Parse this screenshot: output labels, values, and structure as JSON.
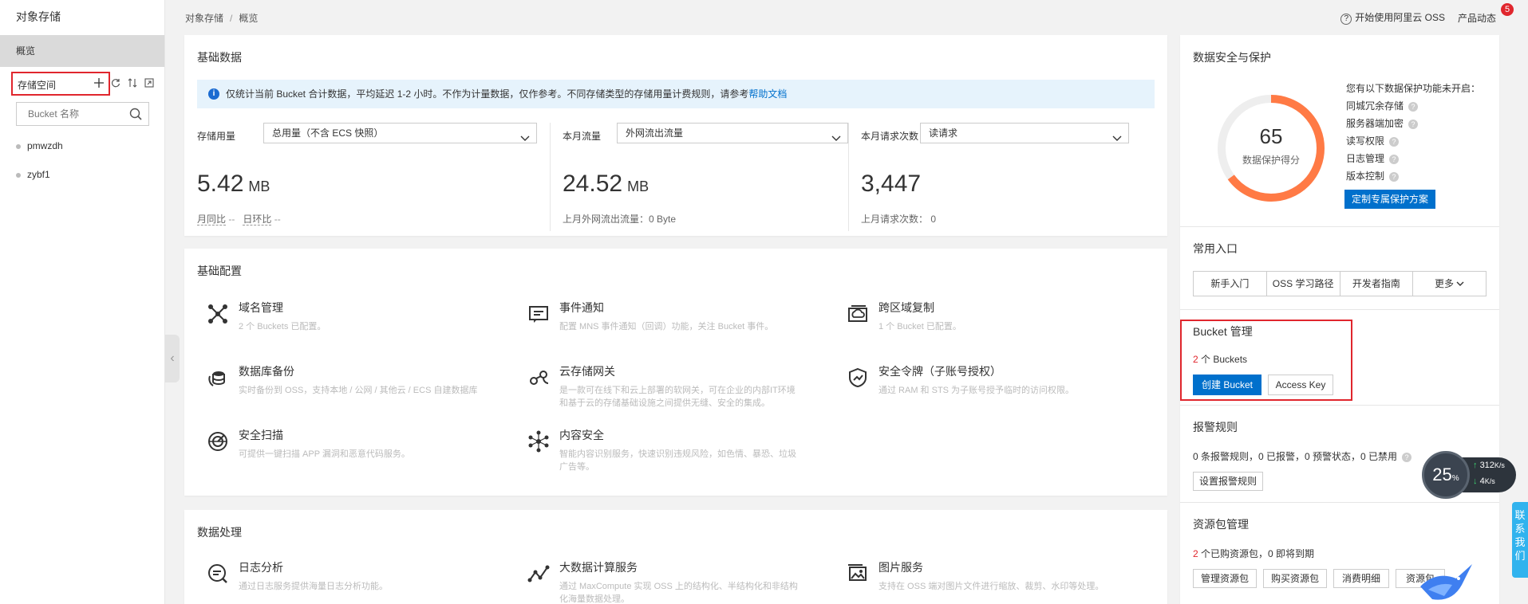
{
  "sidebar": {
    "title": "对象存储",
    "overview": "概览",
    "section_label": "存储空间",
    "search_placeholder": "Bucket 名称",
    "buckets": [
      "pmwzdh",
      "zybf1"
    ]
  },
  "topbar": {
    "breadcrumb": [
      "对象存储",
      "概览"
    ],
    "help_link": "开始使用阿里云 OSS",
    "product_news": "产品动态",
    "news_count": "5"
  },
  "basic_data": {
    "title": "基础数据",
    "notice": "仅统计当前 Bucket 合计数据，平均延迟 1-2 小时。不作为计量数据，仅作参考。不同存储类型的存储用量计费规则，请参考",
    "notice_link": "帮助文档",
    "stats": [
      {
        "label": "存储用量",
        "select": "总用量（不含 ECS 快照）",
        "value": "5.42",
        "unit": "MB",
        "sub_a": "月同比",
        "sub_a_val": "--",
        "sub_b": "日环比",
        "sub_b_val": "--"
      },
      {
        "label": "本月流量",
        "select": "外网流出流量",
        "value": "24.52",
        "unit": "MB",
        "sub": "上月外网流出流量：0 Byte"
      },
      {
        "label": "本月请求次数",
        "select": "读请求",
        "value": "3,447",
        "unit": "",
        "sub": "上月请求次数：   0"
      }
    ]
  },
  "basic_config": {
    "title": "基础配置",
    "features": [
      {
        "name": "域名管理",
        "desc": "2 个 Buckets 已配置。"
      },
      {
        "name": "事件通知",
        "desc": "配置 MNS 事件通知（回调）功能，关注 Bucket 事件。"
      },
      {
        "name": "跨区域复制",
        "desc": "1 个 Bucket 已配置。"
      },
      {
        "name": "数据库备份",
        "desc": "实时备份到 OSS，支持本地 / 公网 / 其他云 / ECS 自建数据库"
      },
      {
        "name": "云存储网关",
        "desc": "是一款可在线下和云上部署的软网关，可在企业的内部IT环境和基于云的存储基础设施之间提供无缝、安全的集成。"
      },
      {
        "name": "安全令牌（子账号授权）",
        "desc": "通过 RAM 和 STS 为子账号授予临时的访问权限。"
      },
      {
        "name": "安全扫描",
        "desc": "可提供一键扫描 APP 漏洞和恶意代码服务。"
      },
      {
        "name": "内容安全",
        "desc": "智能内容识别服务，快速识别违规风险，如色情、暴恐、垃圾广告等。"
      }
    ]
  },
  "data_processing": {
    "title": "数据处理",
    "features": [
      {
        "name": "日志分析",
        "desc": "通过日志服务提供海量日志分析功能。"
      },
      {
        "name": "大数据计算服务",
        "desc": "通过 MaxCompute 实现 OSS 上的结构化、半结构化和非结构化海量数据处理。"
      },
      {
        "name": "图片服务",
        "desc": "支持在 OSS 端对图片文件进行缩放、裁剪、水印等处理。"
      }
    ]
  },
  "security": {
    "title": "数据安全与保护",
    "score": "65",
    "score_fraction": 0.65,
    "score_label": "数据保护得分",
    "intro": "您有以下数据保护功能未开启：",
    "items": [
      "同城冗余存储",
      "服务器端加密",
      "读写权限",
      "日志管理",
      "版本控制"
    ],
    "button": "定制专属保护方案"
  },
  "common_entry": {
    "title": "常用入口",
    "tabs": [
      "新手入门",
      "OSS 学习路径",
      "开发者指南",
      "更多"
    ]
  },
  "bucket_mgmt": {
    "title": "Bucket 管理",
    "count": "2",
    "count_suffix": " 个 Buckets",
    "create_button": "创建 Bucket",
    "access_key_button": "Access Key"
  },
  "alarm": {
    "title": "报警规则",
    "summary": "0 条报警规则，0 已报警，0 预警状态，0 已禁用",
    "button": "设置报警规则"
  },
  "resource_pkg": {
    "title": "资源包管理",
    "count": "2",
    "summary": " 个已购资源包，0 即将到期",
    "buttons": [
      "管理资源包",
      "购买资源包",
      "消费明细",
      "资源包"
    ]
  },
  "widget": {
    "percent": "25",
    "percent_unit": "%",
    "up": "312",
    "down": "4",
    "speed_unit": "K/s"
  },
  "chat": {
    "label": "联系我们"
  },
  "colors": {
    "accent": "#0070cc",
    "highlight": "#e0262d",
    "gauge": "#ff7a45"
  }
}
